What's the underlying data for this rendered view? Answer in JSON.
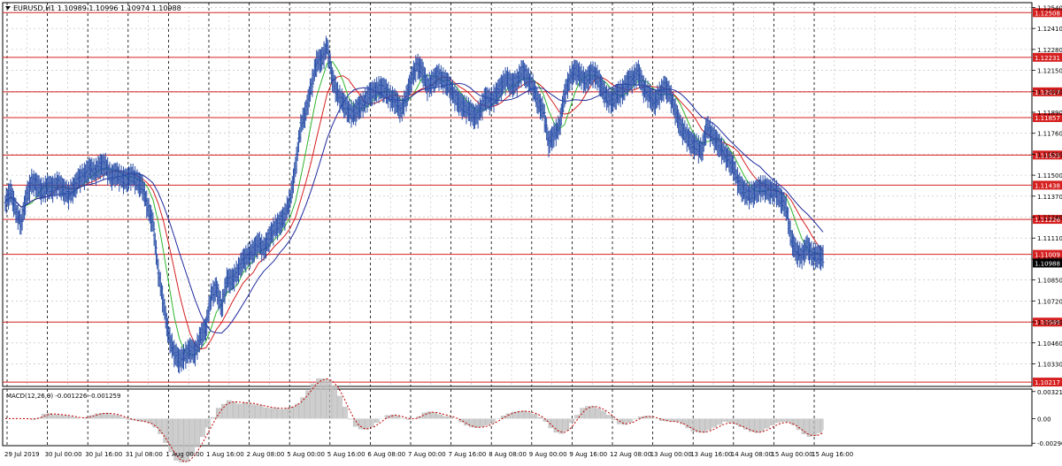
{
  "header": {
    "symbol_line": "EURUSD,H1  1.10989 1.10996 1.10974 1.10988",
    "macd_label": "MACD(12,26,9) -0.001226 -0.001259"
  },
  "price_axis": {
    "labels": [
      "1.12540",
      "1.12410",
      "1.12280",
      "1.12150",
      "1.12020",
      "1.11890",
      "1.11760",
      "1.11630",
      "1.11500",
      "1.11370",
      "1.11240",
      "1.11110",
      "1.10980",
      "1.10850",
      "1.10720",
      "1.10590",
      "1.10460",
      "1.10330",
      "1.10200"
    ],
    "min": 1.1019,
    "max": 1.1257
  },
  "macd_axis": {
    "labels": [
      "0.00321",
      "0.00",
      "-0.002908"
    ],
    "min": -0.0032,
    "max": 0.0035
  },
  "time_axis": {
    "labels": [
      "29 Jul 2019",
      "30 Jul 00:00",
      "30 Jul 16:00",
      "31 Jul 08:00",
      "1 Aug 00:00",
      "1 Aug 16:00",
      "2 Aug 08:00",
      "5 Aug 00:00",
      "5 Aug 16:00",
      "6 Aug 08:00",
      "7 Aug 00:00",
      "7 Aug 16:00",
      "8 Aug 08:00",
      "9 Aug 00:00",
      "9 Aug 16:00",
      "12 Aug 08:00",
      "13 Aug 00:00",
      "13 Aug 16:00",
      "14 Aug 08:00",
      "15 Aug 00:00",
      "15 Aug 16:00"
    ]
  },
  "levels": [
    {
      "label": "1.12508",
      "value": 1.12508
    },
    {
      "label": "1.12231",
      "value": 1.12231
    },
    {
      "label": "1.12017",
      "value": 1.12017
    },
    {
      "label": "1.11857",
      "value": 1.11857
    },
    {
      "label": "1.11625",
      "value": 1.11625
    },
    {
      "label": "1.11438",
      "value": 1.11438
    },
    {
      "label": "1.11226",
      "value": 1.11226
    },
    {
      "label": "1.11009",
      "value": 1.11009
    },
    {
      "label": "1.10589",
      "value": 1.10589
    },
    {
      "label": "1.10217",
      "value": 1.10217
    }
  ],
  "current_price": {
    "label": "1.10988",
    "value": 1.10988
  },
  "colors": {
    "price": "#2a4fa8",
    "level": "#d62020",
    "ma_fast": "#2db52d",
    "ma_mid": "#d62020",
    "ma_slow": "#1f2a9c",
    "macd_hist": "#c0c0c0",
    "macd_signal": "#c00000"
  },
  "chart_data": {
    "type": "line",
    "title": "EURUSD,H1",
    "x_labels": [
      "29 Jul 2019",
      "30 Jul 00:00",
      "30 Jul 16:00",
      "31 Jul 08:00",
      "1 Aug 00:00",
      "1 Aug 16:00",
      "2 Aug 08:00",
      "5 Aug 00:00",
      "5 Aug 16:00",
      "6 Aug 08:00",
      "7 Aug 00:00",
      "7 Aug 16:00",
      "8 Aug 08:00",
      "9 Aug 00:00",
      "9 Aug 16:00",
      "12 Aug 08:00",
      "13 Aug 00:00",
      "13 Aug 16:00",
      "14 Aug 08:00",
      "15 Aug 00:00",
      "15 Aug 16:00"
    ],
    "ylim": [
      1.1019,
      1.1257
    ],
    "grid": true,
    "series": [
      {
        "values": [
          1.1133,
          1.114,
          1.1128,
          1.112,
          1.1137,
          1.1146,
          1.1144,
          1.114,
          1.1143,
          1.1142,
          1.1145,
          1.1141,
          1.1138,
          1.1142,
          1.1148,
          1.115,
          1.1154,
          1.1152,
          1.1156,
          1.1156,
          1.1149,
          1.1151,
          1.1148,
          1.1147,
          1.115,
          1.1146,
          1.1143,
          1.113,
          1.112,
          1.109,
          1.107,
          1.105,
          1.104,
          1.1035,
          1.1038,
          1.1042,
          1.104,
          1.105,
          1.1055,
          1.1075,
          1.108,
          1.1068,
          1.1085,
          1.1085,
          1.109,
          1.1097,
          1.11,
          1.1103,
          1.1108,
          1.1104,
          1.1111,
          1.1117,
          1.112,
          1.1125,
          1.1135,
          1.1155,
          1.118,
          1.119,
          1.1205,
          1.122,
          1.1222,
          1.123,
          1.121,
          1.12,
          1.1195,
          1.119,
          1.1188,
          1.1192,
          1.1195,
          1.12,
          1.1202,
          1.1204,
          1.1203,
          1.1198,
          1.1196,
          1.119,
          1.1198,
          1.121,
          1.1218,
          1.1215,
          1.1205,
          1.1208,
          1.1212,
          1.1209,
          1.1206,
          1.12,
          1.1195,
          1.1192,
          1.119,
          1.1186,
          1.119,
          1.1198,
          1.1196,
          1.12,
          1.1205,
          1.121,
          1.1206,
          1.1208,
          1.1215,
          1.121,
          1.1205,
          1.1195,
          1.119,
          1.117,
          1.1175,
          1.118,
          1.12,
          1.121,
          1.1215,
          1.1212,
          1.1208,
          1.1213,
          1.1212,
          1.1205,
          1.1198,
          1.1196,
          1.12,
          1.1202,
          1.1208,
          1.121,
          1.1214,
          1.1204,
          1.12,
          1.1195,
          1.12,
          1.1205,
          1.12,
          1.119,
          1.118,
          1.1175,
          1.117,
          1.1168,
          1.1165,
          1.118,
          1.1175,
          1.117,
          1.1165,
          1.116,
          1.1155,
          1.1145,
          1.114,
          1.1138,
          1.1139,
          1.1142,
          1.1142,
          1.114,
          1.114,
          1.1135,
          1.113,
          1.111,
          1.1102,
          1.11,
          1.1106,
          1.11,
          1.11,
          1.1099
        ]
      }
    ]
  }
}
